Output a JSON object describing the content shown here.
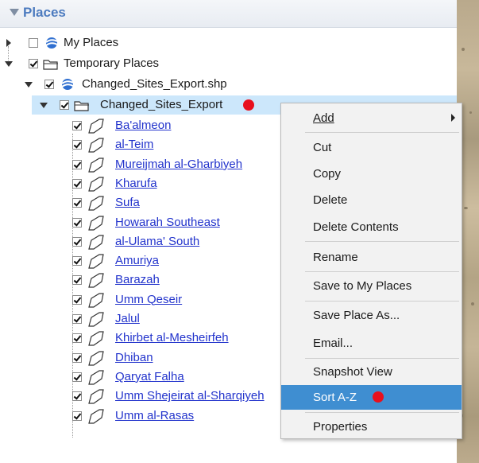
{
  "panel": {
    "title": "Places"
  },
  "tree": {
    "my_places": "My Places",
    "temporary_places": "Temporary Places",
    "shp_file": "Changed_Sites_Export.shp",
    "folder": "Changed_Sites_Export",
    "sites": [
      "Ba'almeon",
      "al-Teim",
      "Mureijmah al-Gharbiyeh",
      "Kharufa",
      "Sufa",
      "Howarah Southeast",
      "al-Ulama' South",
      "Amuriya",
      "Barazah",
      "Umm Qeseir",
      "Jalul",
      "Khirbet al-Mesheirfeh",
      "Dhiban",
      "Qaryat Falha",
      "Umm Shejeirat al-Sharqiyeh",
      "Umm al-Rasas"
    ]
  },
  "context_menu": {
    "add": "Add",
    "cut": "Cut",
    "copy": "Copy",
    "delete": "Delete",
    "delete_contents": "Delete Contents",
    "rename": "Rename",
    "save_to_my_places": "Save to My Places",
    "save_place_as": "Save Place As...",
    "email": "Email...",
    "snapshot_view": "Snapshot View",
    "sort_az": "Sort A-Z",
    "properties": "Properties"
  },
  "colors": {
    "highlight": "#cce7fb",
    "menu_active": "#3f8ed1",
    "link": "#2233cc",
    "marker": "#e8101d"
  }
}
